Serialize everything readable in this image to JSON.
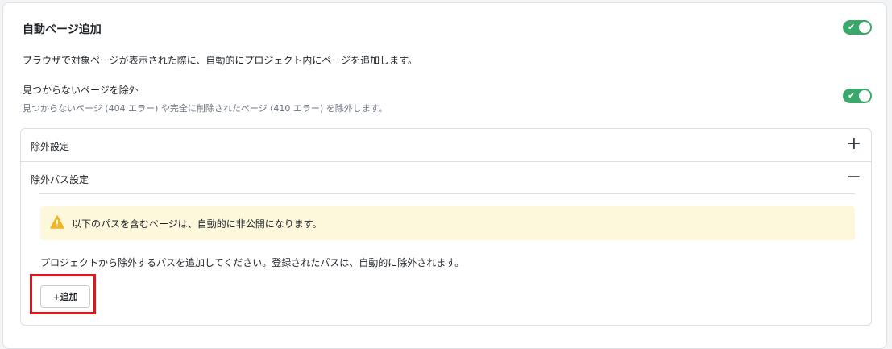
{
  "section": {
    "title": "自動ページ追加",
    "description": "ブラウザで対象ページが表示された際に、自動的にプロジェクト内にページを追加します。",
    "enabled": true
  },
  "exclude_not_found": {
    "label": "見つからないページを除外",
    "sublabel": "見つからないページ (404 エラー) や完全に削除されたページ (410 エラー) を除外します。",
    "enabled": true
  },
  "accordion": {
    "panels": [
      {
        "label": "除外設定",
        "state": "collapsed",
        "sign": "+"
      },
      {
        "label": "除外パス設定",
        "state": "expanded",
        "sign": "−"
      }
    ]
  },
  "exclude_paths": {
    "warning": "以下のパスを含むページは、自動的に非公開になります。",
    "info": "プロジェクトから除外するパスを追加してください。登録されたパスは、自動的に除外されます。",
    "add_button_label": "+追加"
  },
  "colors": {
    "toggle_on": "#3aa86b",
    "warning_bg": "#fdf7dc",
    "warning_icon": "#f0b429",
    "highlight": "#e0161e"
  }
}
